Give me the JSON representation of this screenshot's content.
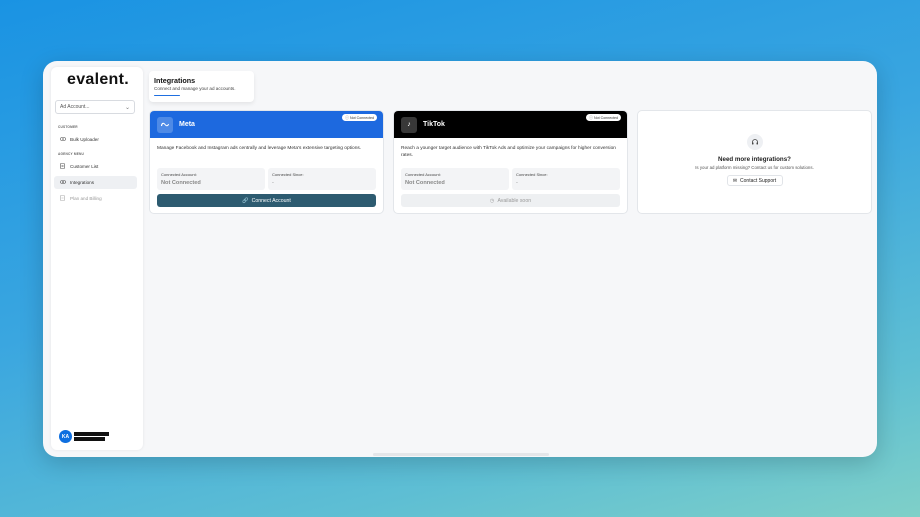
{
  "app": {
    "logo": "evalent."
  },
  "sidebar": {
    "account_select": {
      "value": "Ad Account...",
      "chevron": "chevron-down-icon"
    },
    "sections": [
      {
        "label": "CUSTOMER",
        "items": [
          {
            "label": "Bulk Uploader",
            "icon": "eye-icon"
          }
        ]
      },
      {
        "label": "AGENCY MENU",
        "items": [
          {
            "label": "Customer List",
            "icon": "document-icon"
          },
          {
            "label": "Integrations",
            "icon": "link-icon",
            "active": true
          },
          {
            "label": "Plan and Billing",
            "icon": "billing-icon",
            "disabled": true
          }
        ]
      }
    ],
    "user": {
      "initials": "KA"
    }
  },
  "header": {
    "title": "Integrations",
    "subtitle": "Connect and manage your ad accounts.",
    "accent_color": "#1f6fe0"
  },
  "integrations": [
    {
      "name": "Meta",
      "header_color": "#1d69df",
      "status": "Not Connected",
      "description": "Manage Facebook and Instagram ads centrally and leverage Meta's extensive targeting options.",
      "connected_account_label": "Connected Account:",
      "connected_account_value": "Not Connected",
      "connected_since_label": "Connected Since:",
      "connected_since_value": "-",
      "button_label": "Connect Account",
      "button_icon": "link-icon"
    },
    {
      "name": "TikTok",
      "header_color": "#000000",
      "status": "Not Connected",
      "description": "Reach a younger target audience with TikTok Ads and optimize your campaigns for higher conversion rates.",
      "connected_account_label": "Connected Account:",
      "connected_account_value": "Not Connected",
      "connected_since_label": "Connected Since:",
      "connected_since_value": "-",
      "button_label": "Available soon",
      "button_icon": "clock-icon"
    }
  ],
  "support": {
    "title": "Need more integrations?",
    "text": "Is your ad platform missing? Contact us for custom solutions.",
    "button_label": "Contact Support",
    "icon": "headset-icon"
  }
}
